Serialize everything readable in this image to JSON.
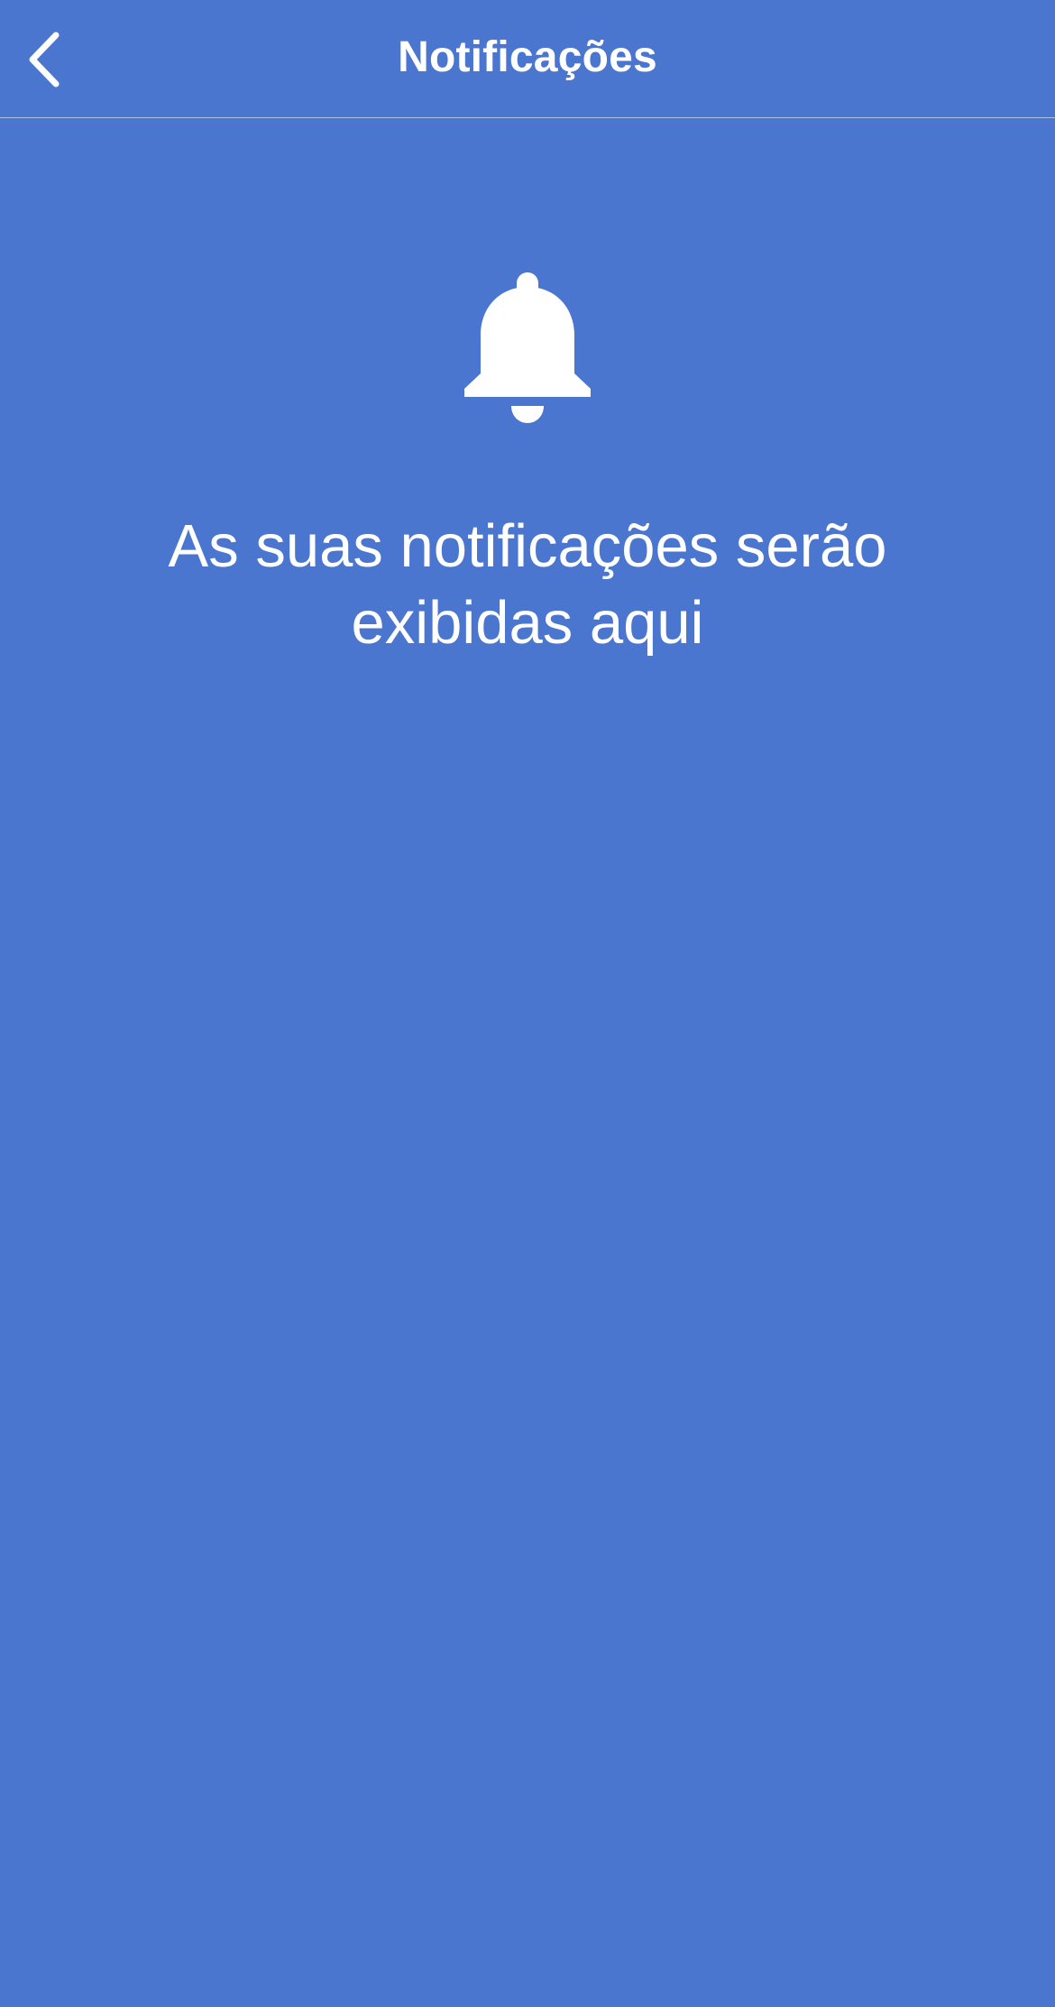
{
  "header": {
    "title": "Notificações",
    "back_icon": "chevron-left-icon"
  },
  "empty_state": {
    "icon": "bell-icon",
    "message": "As suas notificações serão exibidas aqui"
  },
  "colors": {
    "background": "#4A76CF",
    "foreground": "#FFFFFF"
  }
}
